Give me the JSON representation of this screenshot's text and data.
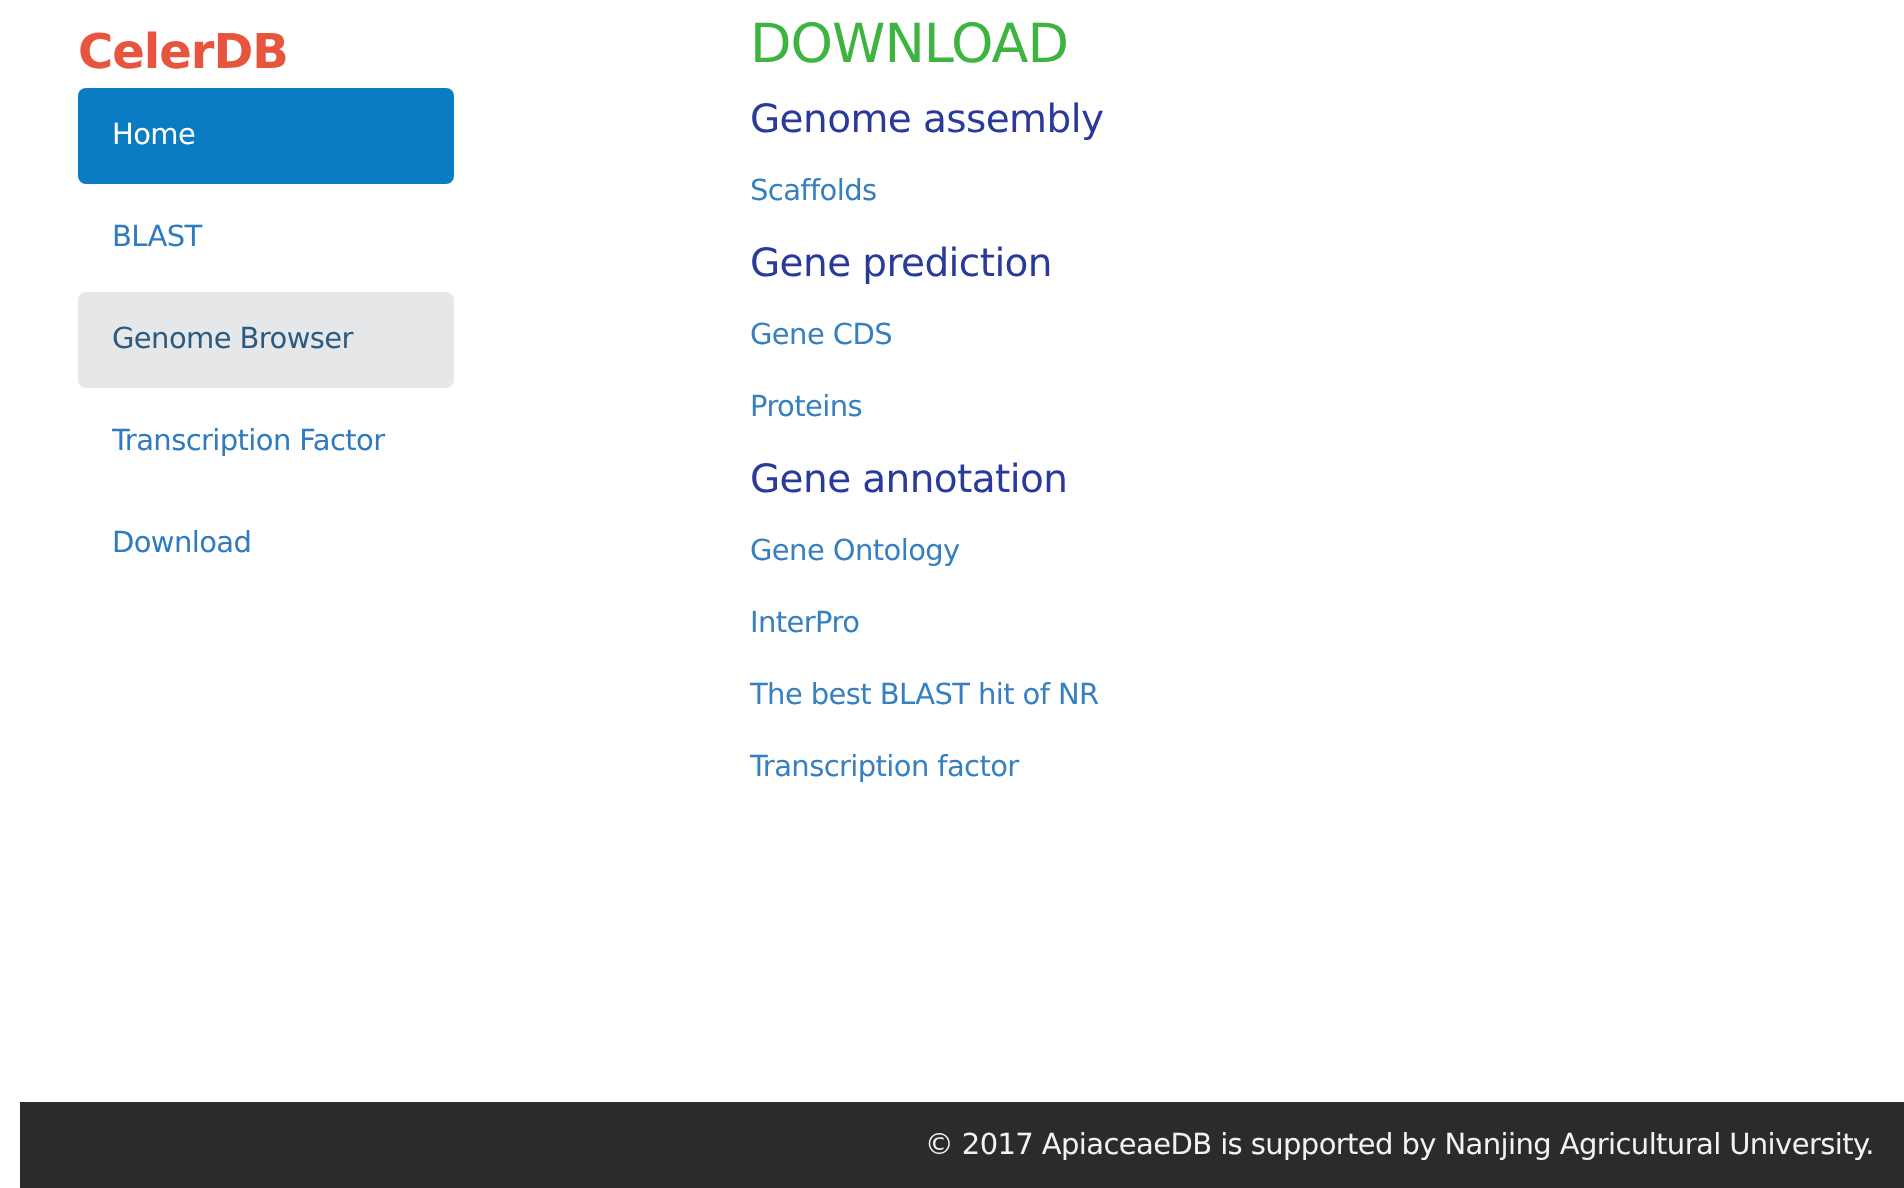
{
  "logo": "CelerDB",
  "nav": [
    {
      "label": "Home",
      "selected": true,
      "highlighted": false
    },
    {
      "label": "BLAST",
      "selected": false,
      "highlighted": false
    },
    {
      "label": "Genome Browser",
      "selected": false,
      "highlighted": true
    },
    {
      "label": "Transcription Factor",
      "selected": false,
      "highlighted": false
    },
    {
      "label": "Download",
      "selected": false,
      "highlighted": false
    }
  ],
  "page_title": "DOWNLOAD",
  "sections": [
    {
      "heading": "Genome assembly",
      "links": [
        "Scaffolds"
      ]
    },
    {
      "heading": "Gene prediction",
      "links": [
        "Gene CDS",
        "Proteins"
      ]
    },
    {
      "heading": "Gene annotation",
      "links": [
        "Gene Ontology",
        "InterPro",
        "The best BLAST hit of NR",
        "Transcription factor"
      ]
    }
  ],
  "footer": "© 2017 ApiaceaeDB is supported by Nanjing Agricultural University."
}
